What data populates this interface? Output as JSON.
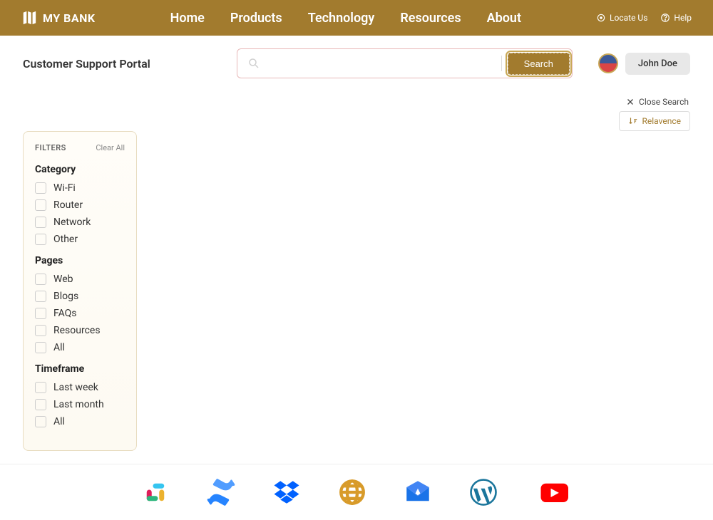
{
  "header": {
    "brand": "MY BANK",
    "nav": [
      "Home",
      "Products",
      "Technology",
      "Resources",
      "About"
    ],
    "locate": "Locate Us",
    "help": "Help"
  },
  "portal": {
    "title": "Customer Support Portal"
  },
  "search": {
    "placeholder": "",
    "button": "Search",
    "close": "Close Search",
    "relevance": "Relavence"
  },
  "user": {
    "name": "John Doe"
  },
  "filters": {
    "title": "FILTERS",
    "clear": "Clear All",
    "sections": [
      {
        "heading": "Category",
        "items": [
          "Wi-Fi",
          "Router",
          "Network",
          "Other"
        ]
      },
      {
        "heading": "Pages",
        "items": [
          "Web",
          "Blogs",
          "FAQs",
          "Resources",
          "All"
        ]
      },
      {
        "heading": "Timeframe",
        "items": [
          "Last week",
          "Last month",
          "All"
        ]
      }
    ]
  },
  "footer_icons": [
    "slack",
    "confluence",
    "dropbox",
    "globe",
    "mail",
    "wordpress",
    "youtube"
  ]
}
